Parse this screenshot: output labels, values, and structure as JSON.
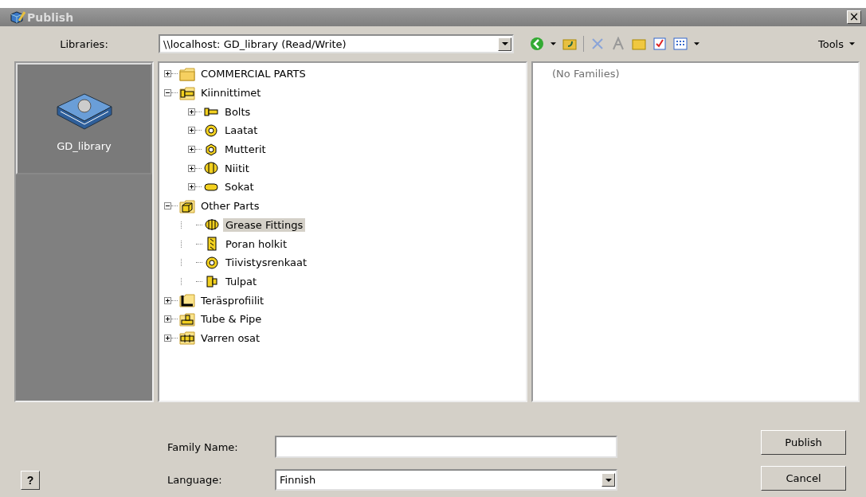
{
  "window": {
    "title": "Publish",
    "close": "×"
  },
  "libraries": {
    "label": "Libraries:",
    "value": "\\\\localhost: GD_library (Read/Write)"
  },
  "toolbar": {
    "tools": "Tools"
  },
  "library_pane": {
    "items": [
      {
        "label": "GD_library",
        "selected": true
      }
    ]
  },
  "tree": [
    {
      "label": "COMMERCIAL PARTS",
      "kind": "folder",
      "expanded": false,
      "selected": false
    },
    {
      "label": "Kiinnittimet",
      "kind": "bolt-folder",
      "expanded": true,
      "selected": false,
      "children": [
        {
          "label": "Bolts",
          "kind": "bolt",
          "expanded": false,
          "selected": false
        },
        {
          "label": "Laatat",
          "kind": "washer",
          "expanded": false,
          "selected": false
        },
        {
          "label": "Mutterit",
          "kind": "nut",
          "expanded": false,
          "selected": false
        },
        {
          "label": "Niitit",
          "kind": "rivet",
          "expanded": false,
          "selected": false
        },
        {
          "label": "Sokat",
          "kind": "pin",
          "expanded": false,
          "selected": false
        }
      ]
    },
    {
      "label": "Other Parts",
      "kind": "box-folder",
      "expanded": true,
      "selected": false,
      "children": [
        {
          "label": "Grease Fittings",
          "kind": "fitting",
          "selected": true
        },
        {
          "label": "Poran holkit",
          "kind": "bushing",
          "selected": false
        },
        {
          "label": "Tiivistysrenkaat",
          "kind": "washer",
          "selected": false
        },
        {
          "label": "Tulpat",
          "kind": "plug",
          "selected": false
        }
      ]
    },
    {
      "label": "Teräsprofiilit",
      "kind": "angle-folder",
      "expanded": false,
      "selected": false
    },
    {
      "label": "Tube & Pipe",
      "kind": "pipe-folder",
      "expanded": false,
      "selected": false
    },
    {
      "label": "Varren osat",
      "kind": "shaft-folder",
      "expanded": false,
      "selected": false
    }
  ],
  "families": {
    "empty_text": "(No Families)"
  },
  "form": {
    "family_name_label": "Family Name:",
    "language_label": "Language:",
    "language_value": "Finnish"
  },
  "buttons": {
    "help": "?",
    "publish": "Publish",
    "cancel": "Cancel"
  }
}
